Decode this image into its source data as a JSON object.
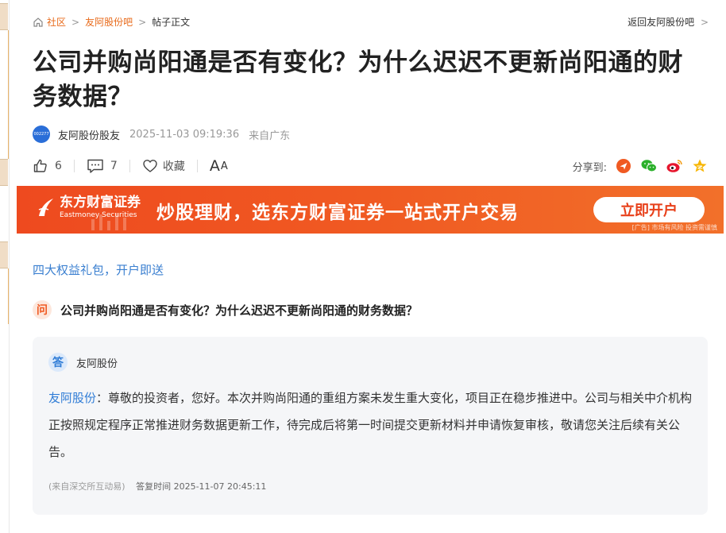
{
  "breadcrumb": {
    "items": [
      "社区",
      "友阿股份吧",
      "帖子正文"
    ],
    "back_link": "返回友阿股份吧"
  },
  "post": {
    "title": "公司并购尚阳通是否有变化？为什么迟迟不更新尚阳通的财务数据？",
    "author": "友阿股份股友",
    "avatar_text": "002277",
    "time": "2025-11-03 09:19:36",
    "location": "来自广东"
  },
  "actions": {
    "likes": "6",
    "comments": "7",
    "favorite_label": "收藏",
    "font_label_big": "A",
    "font_label_small": "A",
    "share_label": "分享到:"
  },
  "banner": {
    "logo_cn": "东方财富证券",
    "logo_en": "Eastmoney Securities",
    "slogan": "炒股理财，选东方财富证券一站式开户交易",
    "button": "立即开户",
    "risk": "[广告] 市场有风险 投资需谨慎"
  },
  "promo": "四大权益礼包，开户即送",
  "question": {
    "badge": "问",
    "text": "公司并购尚阳通是否有变化？为什么迟迟不更新尚阳通的财务数据？"
  },
  "answer": {
    "badge": "答",
    "name": "友阿股份",
    "company": "友阿股份",
    "body": "：尊敬的投资者，您好。本次并购尚阳通的重组方案未发生重大变化，项目正在稳步推进中。公司与相关中介机构正按照规定程序正常推进财务数据更新工作，待完成后将第一时间提交更新材料并申请恢复审核，敬请您关注后续有关公告。",
    "source": "(来自深交所互动易)",
    "reply_time": "答复时间 2025-11-07 20:45:11"
  },
  "colors": {
    "accent": "#e86a1a",
    "link_blue": "#2f7cd6",
    "banner": "#f05a22"
  }
}
